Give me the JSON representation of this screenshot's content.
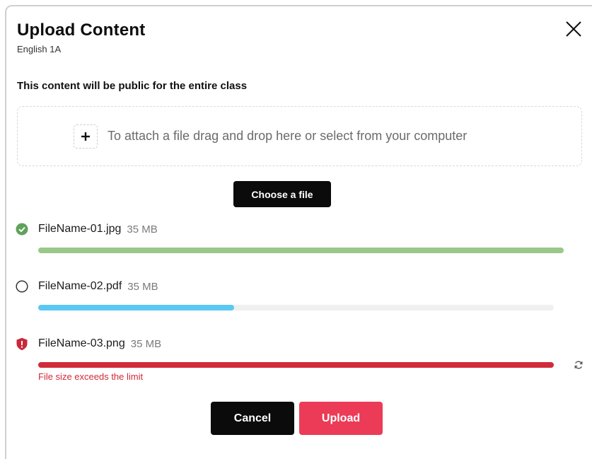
{
  "dialog": {
    "title": "Upload Content",
    "subtitle": "English 1A",
    "notice": "This content will be public for the entire class"
  },
  "dropzone": {
    "text": "To attach a file drag and drop here or select from your computer",
    "icon": "plus-icon"
  },
  "choose_button": "Choose a file",
  "files": [
    {
      "name": "FileName-01.jpg",
      "size": "35 MB",
      "status": "complete",
      "icon": "check-circle-icon",
      "progress": 1.0,
      "color": "#9ac88a"
    },
    {
      "name": "FileName-02.pdf",
      "size": "35 MB",
      "status": "uploading",
      "icon": "empty-circle-icon",
      "progress": 0.38,
      "color": "#5bc8f2"
    },
    {
      "name": "FileName-03.png",
      "size": "35 MB",
      "status": "error",
      "icon": "shield-alert-icon",
      "progress": 1.0,
      "color": "#d02b3a",
      "error": "File size exceeds the limit",
      "action_icon": "retry-icon"
    }
  ],
  "actions": {
    "cancel": "Cancel",
    "upload": "Upload"
  },
  "colors": {
    "primary_dark": "#0b0b0b",
    "accent": "#ec3b56",
    "success": "#9ac88a",
    "progress": "#5bc8f2",
    "error": "#d02b3a"
  }
}
